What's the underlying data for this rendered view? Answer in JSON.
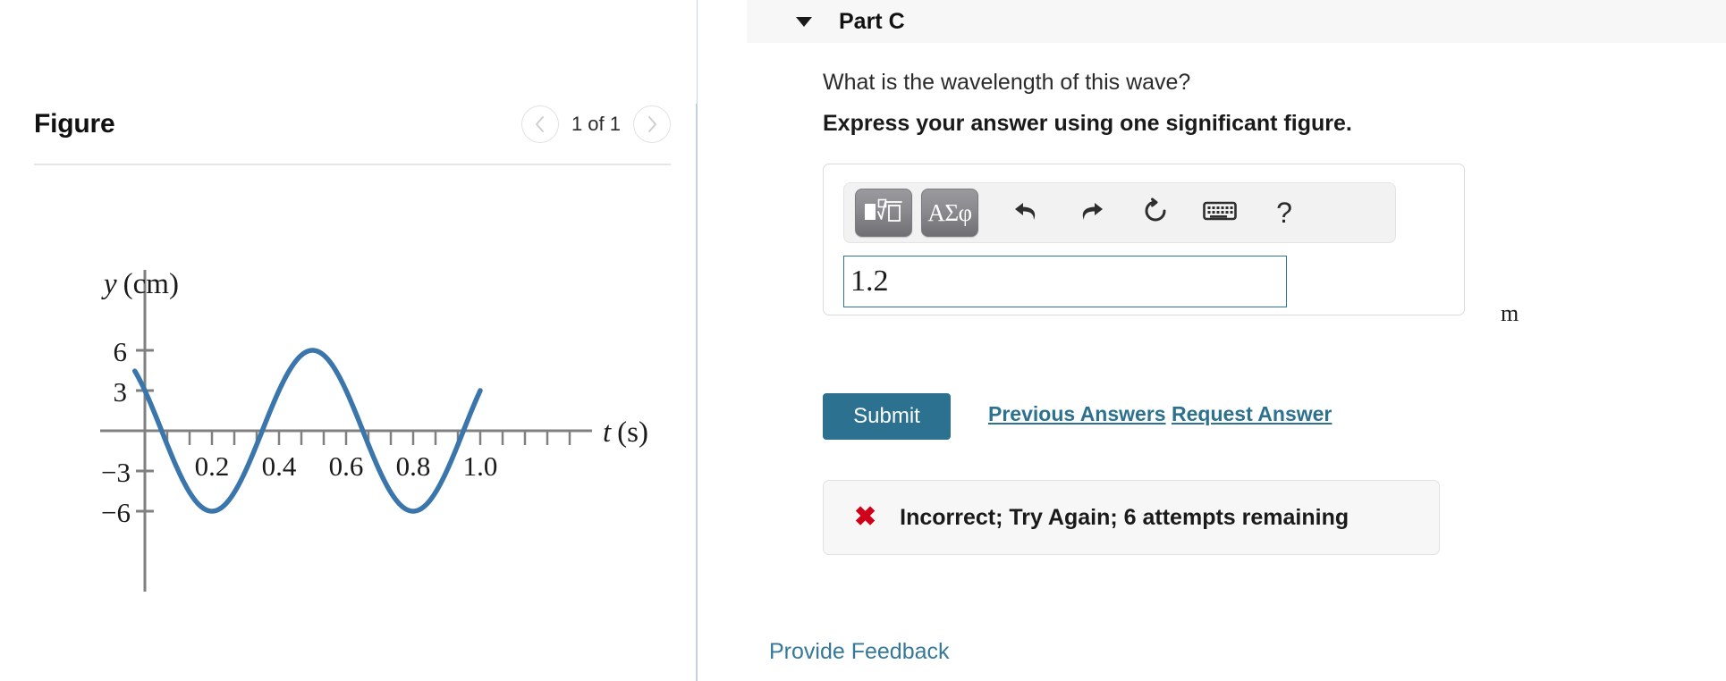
{
  "figure_panel": {
    "title": "Figure",
    "counter": "1 of 1",
    "prev_icon": "chevron-left-icon",
    "next_icon": "chevron-right-icon"
  },
  "question_panel": {
    "part_label": "Part C",
    "caret_icon": "caret-down-icon",
    "question": "What is the wavelength of this wave?",
    "instruction": "Express your answer using one significant figure.",
    "answer": {
      "value": "1.2",
      "placeholder": "",
      "unit": "m"
    },
    "toolbar": {
      "math_template_icon": "math-template-icon",
      "greek_label": "ΑΣφ",
      "undo_icon": "undo-icon",
      "redo_icon": "redo-icon",
      "reset_icon": "reset-icon",
      "keyboard_icon": "keyboard-icon",
      "help_label": "?"
    },
    "submit_label": "Submit",
    "previous_answers_label": "Previous Answers",
    "request_answer_label": "Request Answer",
    "feedback": {
      "icon": "error-x-icon",
      "message": "Incorrect; Try Again; 6 attempts remaining"
    },
    "provide_feedback_label": "Provide Feedback"
  },
  "colors": {
    "accent": "#2c7190",
    "curve": "#3a76ac",
    "error": "#d0021b",
    "divider": "#c3d0e0",
    "header_band": "#f7f7f7"
  },
  "chart_data": {
    "type": "line",
    "title": "",
    "xlabel": "t (s)",
    "ylabel": "y (cm)",
    "xlim": [
      -0.03,
      1.08
    ],
    "ylim": [
      -8.5,
      8.5
    ],
    "grid": false,
    "legend": "none",
    "x_ticks_labeled": [
      0.2,
      0.4,
      0.6,
      0.8,
      1.0
    ],
    "x_tick_labels": [
      "0.2",
      "0.4",
      "0.6",
      "0.8",
      "1.0"
    ],
    "x_minor_tick_step": 0.05,
    "y_ticks_labeled": [
      6,
      3,
      -3,
      -6
    ],
    "y_tick_labels": [
      "6",
      "3",
      "−3",
      "−6"
    ],
    "wave": {
      "amplitude": 6,
      "period": 0.6,
      "equation": "y = 6 cos(2π(t + 0.1)/0.6)",
      "y_at_t0": 3.0,
      "minima_t": [
        0.2,
        0.8
      ],
      "maxima_t": [
        0.5
      ],
      "zero_crossings_t": [
        0.05,
        0.35,
        0.65,
        0.95
      ]
    },
    "x": [
      -0.02,
      0.0,
      0.05,
      0.1,
      0.15,
      0.2,
      0.25,
      0.3,
      0.35,
      0.4,
      0.45,
      0.5,
      0.55,
      0.6,
      0.65,
      0.7,
      0.75,
      0.8,
      0.85,
      0.9,
      0.95,
      1.0
    ],
    "y": [
      4.5,
      3.0,
      0.0,
      -3.0,
      -5.2,
      -6.0,
      -5.2,
      -3.0,
      0.0,
      3.0,
      5.2,
      6.0,
      5.2,
      3.0,
      0.0,
      -3.0,
      -5.2,
      -6.0,
      -5.2,
      -3.0,
      0.0,
      3.3
    ]
  }
}
